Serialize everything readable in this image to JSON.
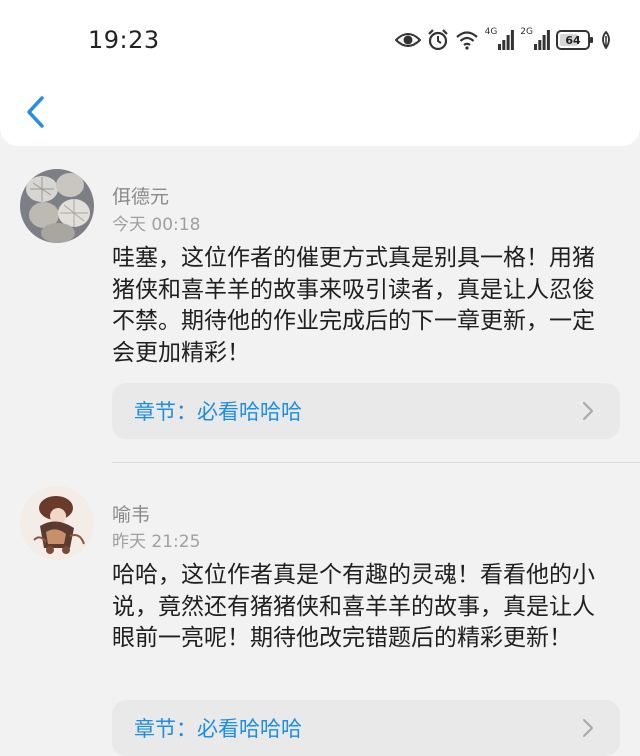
{
  "status_bar": {
    "time": "19:23",
    "network_1": "4G",
    "network_2": "2G",
    "battery_level": "64",
    "icons": [
      "eye-icon",
      "alarm-icon",
      "wifi-icon",
      "signal-icon",
      "signal-icon",
      "battery-icon",
      "leaf-icon"
    ]
  },
  "header": {
    "back_icon": "chevron-left-icon",
    "accent_color": "#2a8fde"
  },
  "comments": [
    {
      "username": "佴德元",
      "time": "今天 00:18",
      "content": "哇塞，这位作者的催更方式真是别具一格！用猪猪侠和喜羊羊的故事来吸引读者，真是让人忍俊不禁。期待他的作业完成后的下一章更新，一定会更加精彩！",
      "chapter_label": "章节：必看哈哈哈"
    },
    {
      "username": "喻韦",
      "time": "昨天 21:25",
      "content": "哈哈，这位作者真是个有趣的灵魂！看看他的小说，竟然还有猪猪侠和喜羊羊的故事，真是让人眼前一亮呢！期待他改完错题后的精彩更新！",
      "chapter_label": "章节：必看哈哈哈"
    }
  ]
}
